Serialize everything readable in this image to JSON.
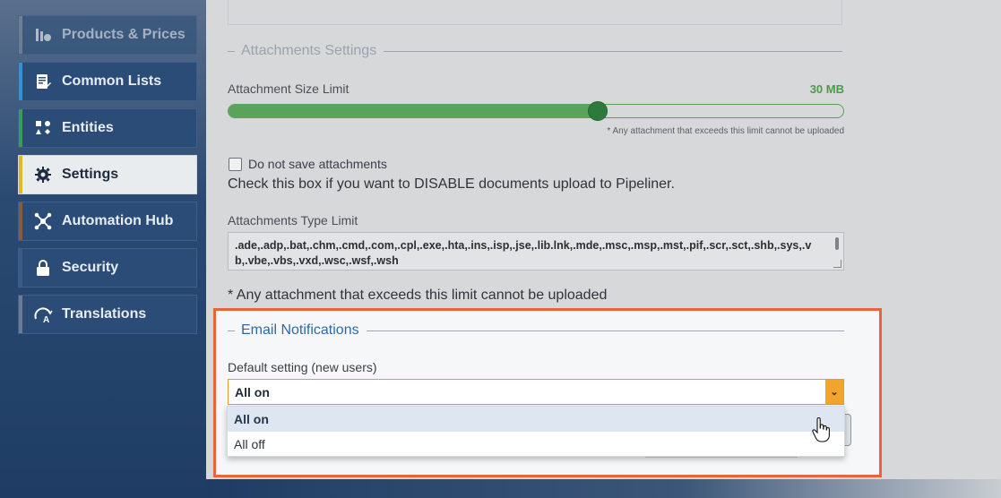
{
  "sidebar": {
    "items": [
      {
        "label": "Products & Prices",
        "icon": "products-prices-icon",
        "color": "#8a8f96"
      },
      {
        "label": "Common Lists",
        "icon": "list-edit-icon",
        "color": "#3b8fd0"
      },
      {
        "label": "Entities",
        "icon": "entities-icon",
        "color": "#3d9a5c"
      },
      {
        "label": "Settings",
        "icon": "gear-icon",
        "color": "#e0b92a"
      },
      {
        "label": "Automation Hub",
        "icon": "automation-hub-icon",
        "color": "#8a5b3a"
      },
      {
        "label": "Security",
        "icon": "lock-icon",
        "color": "#3a5a8a"
      },
      {
        "label": "Translations",
        "icon": "translations-icon",
        "color": "#6b7c92"
      }
    ]
  },
  "attachments": {
    "legend": "Attachments Settings",
    "size_label": "Attachment Size Limit",
    "size_value": "30 MB",
    "size_fraction": 0.6,
    "size_note": "* Any attachment that exceeds this limit cannot be uploaded",
    "checkbox_label": "Do not save attachments",
    "checkbox_checked": false,
    "checkbox_help": "Check this box if you want to DISABLE documents upload to Pipeliner.",
    "type_label": "Attachments Type Limit",
    "type_value": ".ade,.adp,.bat,.chm,.cmd,.com,.cpl,.exe,.hta,.ins,.isp,.jse,.lib.lnk,.mde,.msc,.msp,.mst,.pif,.scr,.sct,.shb,.sys,.vb,.vbe,.vbs,.vxd,.wsc,.wsf,.wsh",
    "type_note": "* Any attachment that exceeds this limit cannot be uploaded"
  },
  "email": {
    "legend": "Email Notifications",
    "default_label": "Default setting (new users)",
    "selected": "All on",
    "options": [
      "All on",
      "All off"
    ]
  },
  "colors": {
    "accent_orange": "#f1a62a",
    "highlight_border": "#e8643f",
    "slider_green": "#5aa35a"
  }
}
